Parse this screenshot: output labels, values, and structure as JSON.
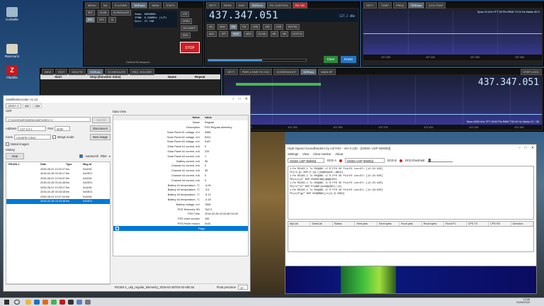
{
  "desktop": {
    "icons": [
      "Corbeille",
      "Raccourci",
      "FileZilla"
    ]
  },
  "sdr_top_left": {
    "tabs": [
      "MENU",
      "MA",
      "PLUGINS",
      "SDRuno",
      "MAIN",
      "STATS",
      "52.43 171M"
    ],
    "row1": [
      "SRT",
      "SCAN",
      "SCHEDULER"
    ],
    "row2": [
      "RF1",
      "RF2",
      "S1"
    ],
    "rates": [
      "Rate Samp",
      "IFBW",
      "Gain"
    ],
    "rate_vals": [
      "Samp: 6000000",
      "IFBW: 6.000MHz (1/P)",
      "Gain: 37.7dB"
    ],
    "btns_right": [
      "LTE",
      "ZERO",
      "DECIMATE",
      "RDS",
      "AGC",
      "STOP"
    ],
    "workspace": "Default Workspace",
    "stop_label": "STOP"
  },
  "sdr_rx": {
    "tabs": [
      "SETT.",
      "REDE",
      "EMX",
      "SDRuno",
      "RX CONTROL",
      "RENUT",
      "RX ON"
    ],
    "freq": "437.347.051",
    "freq_small": "-127.2 dBm",
    "modes": [
      "AM",
      "SAM",
      "FM",
      "CW",
      "DSB",
      "LSB",
      "USB",
      "DIGITAL"
    ],
    "filters": [
      "AGC",
      "OFF",
      "FAST",
      "MED",
      "SLOW",
      "NB",
      "NR",
      "NOTCH"
    ],
    "bottom_btns": [
      "VOLUME",
      "SQL",
      "Clear",
      "Erase"
    ],
    "clear": "Clear",
    "erase": "Erase"
  },
  "sdr_sp": {
    "tabs": [
      "SETT.",
      "TEMP",
      "FREQ",
      "SDRuno",
      "SCN TRAP"
    ],
    "label": "Span 24 kHz  FFT 60 Pts  RBW 73.24 Hz  Marks 30 H",
    "freq_axis": [
      "437.330",
      "437.340",
      "437.350",
      "437.360"
    ]
  },
  "sdr_scheduler": {
    "tabs": [
      "NEW",
      "EDIT",
      "DELETE",
      "SDRuno",
      "SCHEDULER",
      "REC. HOLDER"
    ],
    "cols": [
      "Start",
      "Stop (Duration mins)",
      "Name",
      "Repeat"
    ]
  },
  "sdr_main": {
    "tabs": [
      "SETT.",
      "PWR & SNR TO CSV",
      "SCREENSHOT",
      "SDRuno",
      "MAIN SP",
      "STEP LOCK"
    ],
    "freq": "437.347.051",
    "info": "Span 6000 kHz  FFT 8192 Pts  RBW 732.42 Hz  Marks 21 / 30",
    "freq_axis": [
      "437.300",
      "437.325",
      "437.350",
      "437.375",
      "437.400",
      "437.425",
      "437.450"
    ]
  },
  "decoder": {
    "title": "SatelliteDecoder v1.12",
    "tabs": [
      "UmKA-1",
      "usv",
      "raw"
    ],
    "usp_label": "USP",
    "path": "C:\\Users\\sdr\\SatDecoder\\UmKA-1",
    "out_dir_btn": "Out Dir",
    "address_label": "Address",
    "address_val": "127.0.0.1",
    "port_label": "Port",
    "port_val": "8000",
    "disconnect_btn": "Disconnect",
    "conn_label": "Conn",
    "conn_val": "AGWPE Client",
    "merge_label": "Merge mode",
    "new_image_btn": "New image",
    "dated_images": "Dated images",
    "history_label": "History",
    "clear_btn": "clear",
    "autoscroll": "Autoscroll",
    "filter_label": "Filter",
    "history_root": "RS18S-1",
    "history_cols": [
      "Date",
      "Type",
      "Msg-id"
    ],
    "history_rows": [
      {
        "date": "2026-06-01 10:22:27",
        "type": "tlm",
        "msg": "0x4246"
      },
      {
        "date": "2018-02-28 03:40:17",
        "type": "tlm",
        "msg": "0xDE21"
      },
      {
        "date": "2026-06-01 10:24:57",
        "type": "tlm",
        "msg": "0x4246"
      },
      {
        "date": "2018-02-28 03:42:48",
        "type": "tlm",
        "msg": "0xDE21"
      },
      {
        "date": "2026-06-01 10:25:27",
        "type": "tlm",
        "msg": "0x4246"
      },
      {
        "date": "2018-02-28 03:43:18",
        "type": "tlm",
        "msg": "0xDE21"
      },
      {
        "date": "2026-06-01 10:27:20",
        "type": "tlm",
        "msg": "0x4246"
      },
      {
        "date": "2018-02-28 03:43:48",
        "type": "tlm",
        "msg": "0xDE21"
      }
    ],
    "data_view_label": "Data View",
    "dv_cols": [
      "Name",
      "Value"
    ],
    "dv_rows": [
      {
        "k": "Name",
        "v": "Regular"
      },
      {
        "k": "Description",
        "v": "PSS Regular telemetry"
      },
      {
        "k": "Solar Panel #1 voltage, mV",
        "v": "5386"
      },
      {
        "k": "Solar Panel #2 voltage, mV",
        "v": "5310"
      },
      {
        "k": "Solar Panel #3 voltage, mV",
        "v": "5187"
      },
      {
        "k": "Solar Panel #1 current, mA",
        "v": "0"
      },
      {
        "k": "Solar Panel #2 current, mA",
        "v": "226"
      },
      {
        "k": "Solar Panel #3 current, mA",
        "v": "1"
      },
      {
        "k": "Battery current, mA",
        "v": "36"
      },
      {
        "k": "Channel #1 current, mA",
        "v": "0"
      },
      {
        "k": "Channel #2 current, mA",
        "v": "35"
      },
      {
        "k": "Channel #3 current, mA",
        "v": "0"
      },
      {
        "k": "Channel #4 current, mA",
        "v": "0"
      },
      {
        "k": "Battery #1 temperature, °C",
        "v": "-4.06"
      },
      {
        "k": "Battery #2 temperature, °C",
        "v": "-3.5"
      },
      {
        "k": "Battery #3 temperature, °C",
        "v": "-5.12"
      },
      {
        "k": "Battery #4 temperature, °C",
        "v": "-4.18"
      },
      {
        "k": "Battery voltage, mV",
        "v": "7896"
      },
      {
        "k": "PSS Telemetry SN",
        "v": "76471"
      },
      {
        "k": "PSS Time",
        "v": "2018-02-28 03:43:48+00:00"
      },
      {
        "k": "PSS reset counter",
        "v": "155"
      },
      {
        "k": "PSS Reset reason",
        "v": "0x34"
      }
    ],
    "flags_label": "Flags",
    "status_file": "RS18S-1_usp_regular_telemetry_2018-02-28T03-43-48Z.txt",
    "float_precision_label": "Float precision",
    "float_precision_val": "10"
  },
  "soundmodem": {
    "title": "High-Speed SoundModem by UZ7HO - Ver 0.12b - [GMSK USP 9600bd]",
    "menu": [
      "Settings",
      "View",
      "Clear monitor",
      "About"
    ],
    "modem_a": "GMSK USP 9600bd",
    "modem_b": "GMSK USP 9600bd",
    "dcd_a": "DCD A",
    "dcd_b": "DCD B",
    "dcd_threshold": "DCD threshold",
    "monitor_lines": [
      "1:Fm RS18S-1 To R0Q8BG <I R Pf0 S0 Pid=F0 Len=67> [12:22:32R]",
      "Fhj>s:g> $#P-P;[@-r}k@@Adpb$,,@@IA]",
      "1:Fm RS18S-1 To R0Q8BG <I R Pf0 S0 Pid=F0 Len=67> [12:25:02R]",
      "FBjs)c(p^  $#P-0VN6%7@@jq$@@>B3]",
      "1:Fm RS18S-1 To R0Q8BG <I R Pf0 S0 Pid=F0 Len=67> [12:25:32R]",
      "F8jrs^\"p^  $#P-0*w@@7jqkA@p0@Tj/)3]",
      "1:Fm RS18S-1 To R0Q8BG <I R Pf0 S0 Pid=F0 Len=67> [12:26:02R]",
      "Fbjs(0\"gp^  $#P-NC@@R@bj(v)[d @ VS@3]"
    ],
    "cols": [
      "MyCall",
      "DestCall",
      "Status",
      "Sent pkts",
      "Sent bytes",
      "Rcvd pkts",
      "Rcvd bytes",
      "Rcvd FC",
      "CPS TX",
      "CPS RX",
      "Direction"
    ]
  },
  "taskbar": {
    "time": "12:26",
    "date": "01/06/2020"
  }
}
